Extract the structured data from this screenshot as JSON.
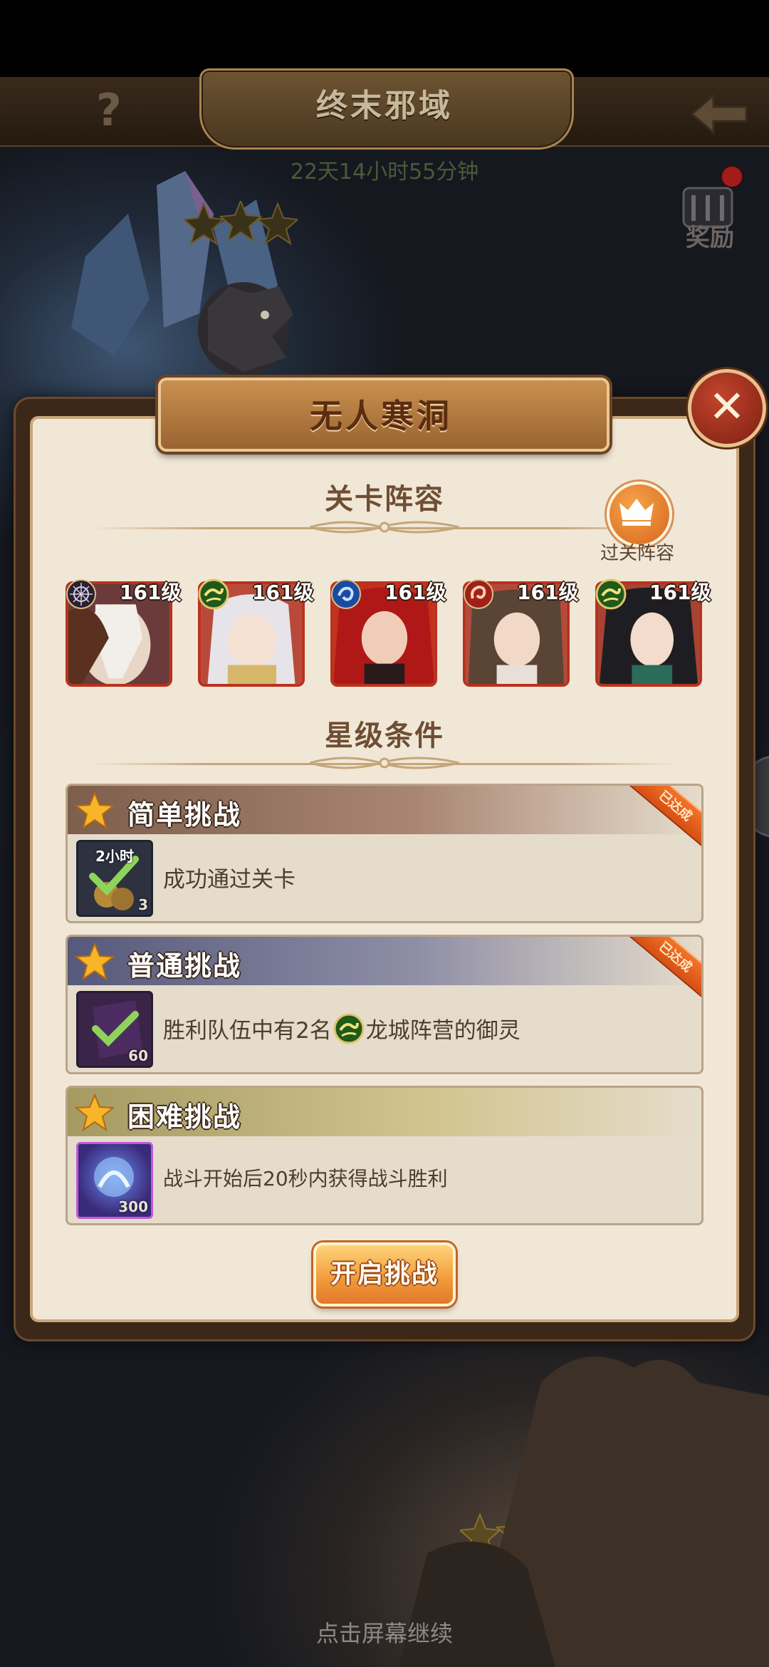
{
  "header": {
    "title": "终末邪域",
    "timer": "22天14小时55分钟",
    "help_glyph": "?",
    "reward_label": "奖励"
  },
  "modal": {
    "title": "无人寒洞",
    "close_glyph": "✕",
    "lineup": {
      "section_title": "关卡阵容",
      "clear_lineup_label": "过关阵容",
      "heroes": [
        {
          "level": "161级",
          "faction": "dark"
        },
        {
          "level": "161级",
          "faction": "dragon"
        },
        {
          "level": "161级",
          "faction": "water"
        },
        {
          "level": "161级",
          "faction": "fire"
        },
        {
          "level": "161级",
          "faction": "dragon"
        }
      ]
    },
    "conditions": {
      "section_title": "星级条件",
      "items": [
        {
          "title": "简单挑战",
          "description": "成功通过关卡",
          "completed": true,
          "ribbon": "已达成",
          "item_label": "2小时",
          "item_qty": "3"
        },
        {
          "title": "普通挑战",
          "description_before": "胜利队伍中有2名",
          "description_after": "龙城阵营的御灵",
          "completed": true,
          "ribbon": "已达成",
          "item_qty": "60"
        },
        {
          "title": "困难挑战",
          "description": "战斗开始后20秒内获得战斗胜利",
          "completed": false,
          "item_qty": "300"
        }
      ]
    },
    "start_button": "开启挑战"
  },
  "footer": {
    "hint": "点击屏幕继续"
  },
  "colors": {
    "modal_bg": "#f1e7d6",
    "accent_orange": "#f09a3a",
    "star_gold": "#f7b52a"
  }
}
